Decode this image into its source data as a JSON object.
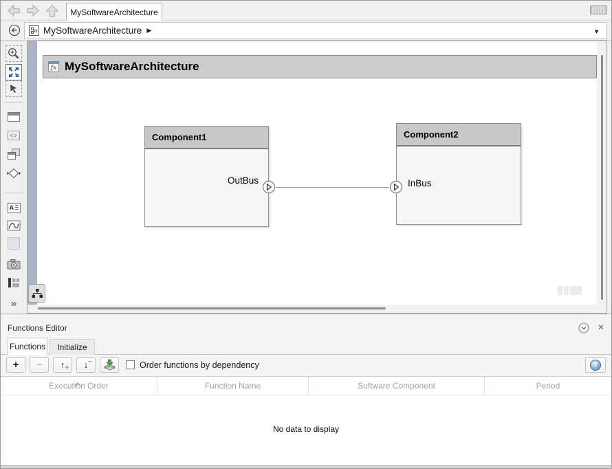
{
  "tab_bar": {
    "tab_title": "MySoftwareArchitecture"
  },
  "breadcrumb": {
    "model_name": "MySoftwareArchitecture",
    "arrow": "▶",
    "dropdown": "▼"
  },
  "diagram": {
    "title": "MySoftwareArchitecture",
    "fx_badge": "fx",
    "components": [
      {
        "name": "Component1",
        "port_label": "OutBus",
        "port_side": "right"
      },
      {
        "name": "Component2",
        "port_label": "InBus",
        "port_side": "left"
      }
    ]
  },
  "functions_editor": {
    "panel_title": "Functions Editor",
    "close_glyph": "✕",
    "tabs": [
      {
        "label": "Functions",
        "active": true
      },
      {
        "label": "Initialize",
        "active": false
      }
    ],
    "toolbar": {
      "add": "+",
      "remove": "−",
      "move_up": "↑",
      "move_up_plus": "+",
      "move_down": "↓",
      "move_down_minus": "−",
      "checkbox_label": "Order functions by dependency",
      "checkbox_checked": false,
      "help": "?"
    },
    "table": {
      "columns": [
        "Execution Order",
        "Function Name",
        "Software Component",
        "Period"
      ],
      "sorted_column": "Execution Order",
      "empty_message": "No data to display"
    }
  },
  "palette": {
    "code_glyph": "<>",
    "annotation_glyph": "A",
    "overflow_glyph": "»"
  },
  "colors": {
    "accent_blue": "#2f5fa8",
    "strip_blue": "#a9b5c7",
    "component_header": "#c8c8c8",
    "diagram_titlebar": "#cbcbcb"
  }
}
